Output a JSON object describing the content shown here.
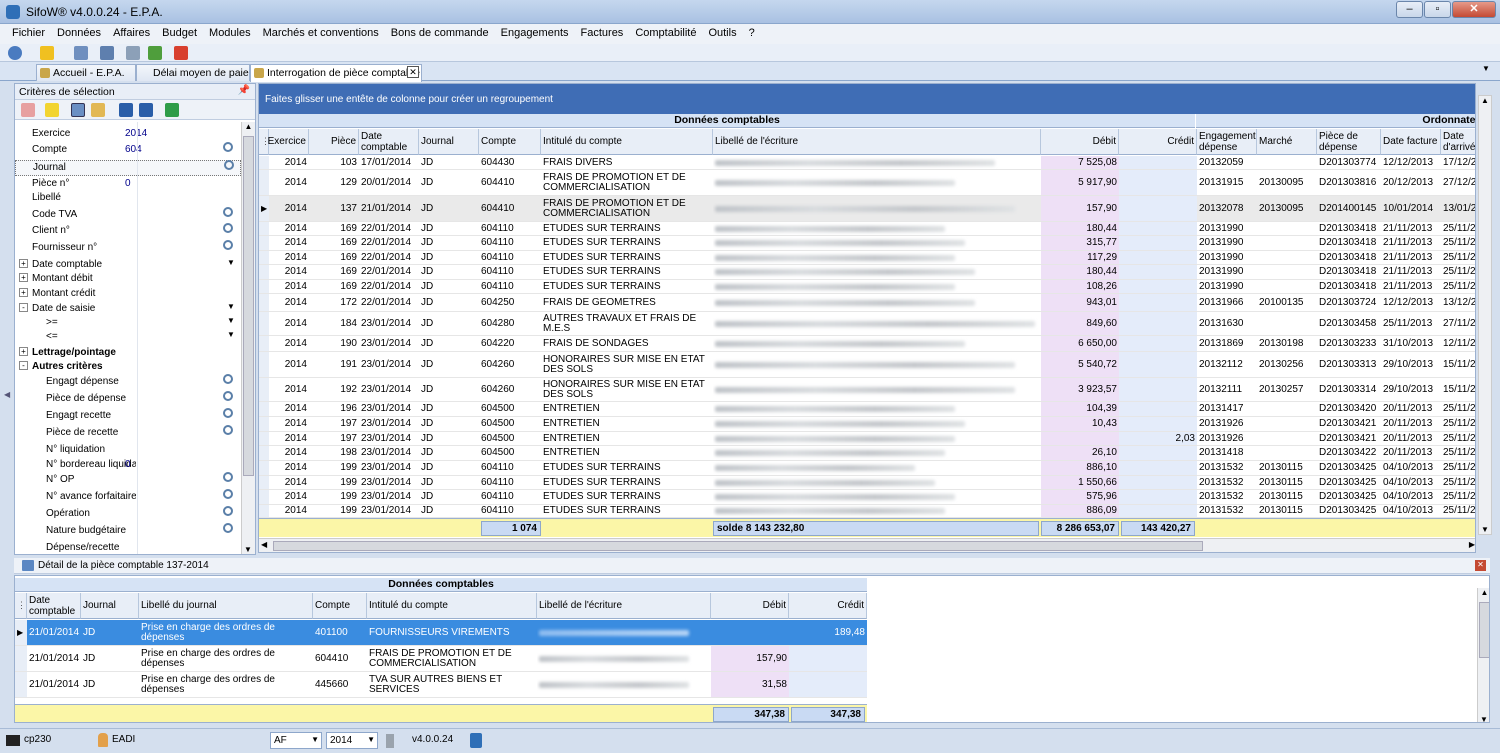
{
  "window": {
    "title": "SifoW® v4.0.0.24 - E.P.A."
  },
  "menu": [
    "Fichier",
    "Données",
    "Affaires",
    "Budget",
    "Modules",
    "Marchés et conventions",
    "Bons de commande",
    "Engagements",
    "Factures",
    "Comptabilité",
    "Outils",
    "?"
  ],
  "tabs": [
    {
      "label": "Accueil - E.P.A."
    },
    {
      "label": "Délai moyen de paiement"
    },
    {
      "label": "Interrogation de pièce comptable"
    }
  ],
  "criteria_panel": {
    "title": "Critères de sélection",
    "items": [
      {
        "label": "Exercice",
        "value": "2014"
      },
      {
        "label": "Compte",
        "value": "604"
      },
      {
        "label": "Journal",
        "value": ""
      },
      {
        "label": "Pièce n°",
        "value": "0"
      },
      {
        "label": "Libellé",
        "value": ""
      },
      {
        "label": "Code TVA",
        "value": ""
      },
      {
        "label": "Client n°",
        "value": ""
      },
      {
        "label": "Fournisseur n°",
        "value": ""
      },
      {
        "label": "Date comptable",
        "value": ""
      },
      {
        "label": "Montant débit",
        "value": ""
      },
      {
        "label": "Montant crédit",
        "value": ""
      },
      {
        "label": "Date de saisie",
        "value": ""
      },
      {
        "label": ">=",
        "value": ""
      },
      {
        "label": "<=",
        "value": ""
      },
      {
        "label": "Lettrage/pointage",
        "value": ""
      },
      {
        "label": "Autres critères",
        "value": ""
      },
      {
        "label": "Engagt dépense",
        "value": ""
      },
      {
        "label": "Pièce de dépense",
        "value": ""
      },
      {
        "label": "Engagt recette",
        "value": ""
      },
      {
        "label": "Pièce de recette",
        "value": ""
      },
      {
        "label": "N° liquidation",
        "value": ""
      },
      {
        "label": "N° bordereau liquidation",
        "value": "0"
      },
      {
        "label": "N° OP",
        "value": ""
      },
      {
        "label": "N° avance forfaitaire",
        "value": ""
      },
      {
        "label": "Opération",
        "value": ""
      },
      {
        "label": "Nature budgétaire",
        "value": ""
      },
      {
        "label": "Dépense/recette",
        "value": ""
      }
    ]
  },
  "main_grid": {
    "group_hint": "Faites glisser une entête de colonne pour créer un regroupement",
    "band1": "Données comptables",
    "band2": "Ordonnateur",
    "columns": [
      "Exercice",
      "Pièce",
      "Date comptable",
      "Journal",
      "Compte",
      "Intitulé du compte",
      "Libellé de l'écriture",
      "Débit",
      "Crédit",
      "Engagement dépense",
      "Marché",
      "Pièce de dépense",
      "Date facture",
      "Date d'arrivée"
    ],
    "rows": [
      [
        "2014",
        "103",
        "17/01/2014",
        "JD",
        "604430",
        "FRAIS DIVERS",
        "",
        "7 525,08",
        "",
        "20132059",
        "",
        "D201303774",
        "12/12/2013",
        "17/12/20"
      ],
      [
        "2014",
        "129",
        "20/01/2014",
        "JD",
        "604410",
        "FRAIS DE PROMOTION ET DE COMMERCIALISATION",
        "",
        "5 917,90",
        "",
        "20131915",
        "20130095",
        "D201303816",
        "20/12/2013",
        "27/12/20"
      ],
      [
        "2014",
        "137",
        "21/01/2014",
        "JD",
        "604410",
        "FRAIS DE PROMOTION ET DE COMMERCIALISATION",
        "",
        "157,90",
        "",
        "20132078",
        "20130095",
        "D201400145",
        "10/01/2014",
        "13/01/20"
      ],
      [
        "2014",
        "169",
        "22/01/2014",
        "JD",
        "604110",
        "ETUDES SUR TERRAINS",
        "",
        "180,44",
        "",
        "20131990",
        "",
        "D201303418",
        "21/11/2013",
        "25/11/20"
      ],
      [
        "2014",
        "169",
        "22/01/2014",
        "JD",
        "604110",
        "ETUDES SUR TERRAINS",
        "",
        "315,77",
        "",
        "20131990",
        "",
        "D201303418",
        "21/11/2013",
        "25/11/20"
      ],
      [
        "2014",
        "169",
        "22/01/2014",
        "JD",
        "604110",
        "ETUDES SUR TERRAINS",
        "",
        "117,29",
        "",
        "20131990",
        "",
        "D201303418",
        "21/11/2013",
        "25/11/20"
      ],
      [
        "2014",
        "169",
        "22/01/2014",
        "JD",
        "604110",
        "ETUDES SUR TERRAINS",
        "",
        "180,44",
        "",
        "20131990",
        "",
        "D201303418",
        "21/11/2013",
        "25/11/20"
      ],
      [
        "2014",
        "169",
        "22/01/2014",
        "JD",
        "604110",
        "ETUDES SUR TERRAINS",
        "",
        "108,26",
        "",
        "20131990",
        "",
        "D201303418",
        "21/11/2013",
        "25/11/20"
      ],
      [
        "2014",
        "172",
        "22/01/2014",
        "JD",
        "604250",
        "FRAIS DE GEOMETRES",
        "",
        "943,01",
        "",
        "20131966",
        "20100135",
        "D201303724",
        "12/12/2013",
        "13/12/20"
      ],
      [
        "2014",
        "184",
        "23/01/2014",
        "JD",
        "604280",
        "AUTRES TRAVAUX ET FRAIS DE M.E.S",
        "",
        "849,60",
        "",
        "20131630",
        "",
        "D201303458",
        "25/11/2013",
        "27/11/20"
      ],
      [
        "2014",
        "190",
        "23/01/2014",
        "JD",
        "604220",
        "FRAIS DE SONDAGES",
        "",
        "6 650,00",
        "",
        "20131869",
        "20130198",
        "D201303233",
        "31/10/2013",
        "12/11/20"
      ],
      [
        "2014",
        "191",
        "23/01/2014",
        "JD",
        "604260",
        "HONORAIRES SUR MISE EN ETAT DES SOLS",
        "",
        "5 540,72",
        "",
        "20132112",
        "20130256",
        "D201303313",
        "29/10/2013",
        "15/11/20"
      ],
      [
        "2014",
        "192",
        "23/01/2014",
        "JD",
        "604260",
        "HONORAIRES SUR MISE EN ETAT DES SOLS",
        "",
        "3 923,57",
        "",
        "20132111",
        "20130257",
        "D201303314",
        "29/10/2013",
        "15/11/20"
      ],
      [
        "2014",
        "196",
        "23/01/2014",
        "JD",
        "604500",
        "ENTRETIEN",
        "",
        "104,39",
        "",
        "20131417",
        "",
        "D201303420",
        "20/11/2013",
        "25/11/20"
      ],
      [
        "2014",
        "197",
        "23/01/2014",
        "JD",
        "604500",
        "ENTRETIEN",
        "",
        "10,43",
        "",
        "20131926",
        "",
        "D201303421",
        "20/11/2013",
        "25/11/20"
      ],
      [
        "2014",
        "197",
        "23/01/2014",
        "JD",
        "604500",
        "ENTRETIEN",
        "",
        "",
        "2,03",
        "20131926",
        "",
        "D201303421",
        "20/11/2013",
        "25/11/20"
      ],
      [
        "2014",
        "198",
        "23/01/2014",
        "JD",
        "604500",
        "ENTRETIEN",
        "",
        "26,10",
        "",
        "20131418",
        "",
        "D201303422",
        "20/11/2013",
        "25/11/20"
      ],
      [
        "2014",
        "199",
        "23/01/2014",
        "JD",
        "604110",
        "ETUDES SUR TERRAINS",
        "",
        "886,10",
        "",
        "20131532",
        "20130115",
        "D201303425",
        "04/10/2013",
        "25/11/20"
      ],
      [
        "2014",
        "199",
        "23/01/2014",
        "JD",
        "604110",
        "ETUDES SUR TERRAINS",
        "",
        "1 550,66",
        "",
        "20131532",
        "20130115",
        "D201303425",
        "04/10/2013",
        "25/11/20"
      ],
      [
        "2014",
        "199",
        "23/01/2014",
        "JD",
        "604110",
        "ETUDES SUR TERRAINS",
        "",
        "575,96",
        "",
        "20131532",
        "20130115",
        "D201303425",
        "04/10/2013",
        "25/11/20"
      ],
      [
        "2014",
        "199",
        "23/01/2014",
        "JD",
        "604110",
        "ETUDES SUR TERRAINS",
        "",
        "886,09",
        "",
        "20131532",
        "20130115",
        "D201303425",
        "04/10/2013",
        "25/11/20"
      ]
    ],
    "footer": {
      "count": "1 074",
      "solde": "solde 8 143 232,80",
      "debit": "8 286 653,07",
      "credit": "143 420,27"
    }
  },
  "detail": {
    "title": "Détail de la pièce comptable 137-2014",
    "band": "Données comptables",
    "columns": [
      "Date comptable",
      "Journal",
      "Libellé du journal",
      "Compte",
      "Intitulé du compte",
      "Libellé de l'écriture",
      "Débit",
      "Crédit"
    ],
    "rows": [
      [
        "21/01/2014",
        "JD",
        "Prise en charge des ordres de dépenses",
        "401100",
        "FOURNISSEURS VIREMENTS",
        "",
        "",
        "189,48"
      ],
      [
        "21/01/2014",
        "JD",
        "Prise en charge des ordres de dépenses",
        "604410",
        "FRAIS DE PROMOTION ET DE COMMERCIALISATION",
        "",
        "157,90",
        ""
      ],
      [
        "21/01/2014",
        "JD",
        "Prise en charge des ordres de dépenses",
        "445660",
        "TVA SUR AUTRES BIENS ET SERVICES",
        "",
        "31,58",
        ""
      ]
    ],
    "footer": {
      "debit": "347,38",
      "credit": "347,38"
    }
  },
  "status": {
    "user": "cp230",
    "profile": "EADI",
    "af": "AF",
    "year": "2014",
    "version": "v4.0.0.24"
  }
}
